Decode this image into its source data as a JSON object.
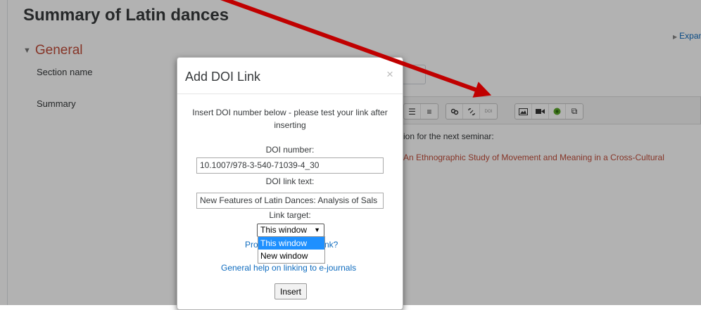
{
  "page": {
    "title": "Summary of Latin dances",
    "expand_label": "Expan",
    "section_heading": "General",
    "section_name_label": "Section name",
    "summary_label": "Summary"
  },
  "editor": {
    "line1": "ion for the next seminar:",
    "line2": "An Ethnographic Study of Movement and Meaning in a Cross-Cultural",
    "toolbar_icons": [
      "unordered-list-icon",
      "ordered-list-icon",
      "link-icon",
      "unlink-icon",
      "doi-link-icon",
      "image-icon",
      "video-icon",
      "record-icon",
      "copy-icon"
    ],
    "doi_button_label": "DOI"
  },
  "modal": {
    "title": "Add DOI Link",
    "close_glyph": "×",
    "intro": "Insert DOI number below - please test your link after inserting",
    "doi_number_label": "DOI number:",
    "doi_number_value": "10.1007/978-3-540-71039-4_30",
    "doi_link_text_label": "DOI link text:",
    "doi_link_text_value": "New Features of Latin Dances: Analysis of Sals",
    "link_target_label": "Link target:",
    "link_target_selected": "This window",
    "link_target_options": [
      "This window",
      "New window"
    ],
    "problem_link_left": "Pro",
    "problem_link_right": "nk?",
    "general_help_link": "General help on linking to e-journals",
    "insert_button": "Insert"
  },
  "colors": {
    "accent_red": "#c14d3a",
    "link_blue": "#0f6cbf",
    "annotation_arrow": "#c00000"
  }
}
